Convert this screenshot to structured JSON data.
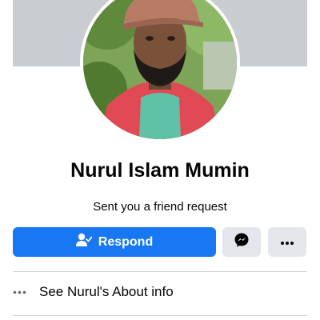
{
  "profile": {
    "name": "Nurul Islam Mumin",
    "subtitle": "Sent you a friend request",
    "avatar_alt": "Profile photo"
  },
  "actions": {
    "respond_label": "Respond",
    "respond_icon": "person-check-icon",
    "messenger_icon": "messenger-icon",
    "more_icon": "more-horizontal-icon"
  },
  "about": {
    "label": "See Nurul's About info",
    "icon": "more-horizontal-icon"
  },
  "colors": {
    "primary": "#1877f2",
    "secondary_button": "#e4e6eb",
    "cover": "#c9ccd1",
    "text": "#050505",
    "divider": "#ced0d4"
  }
}
